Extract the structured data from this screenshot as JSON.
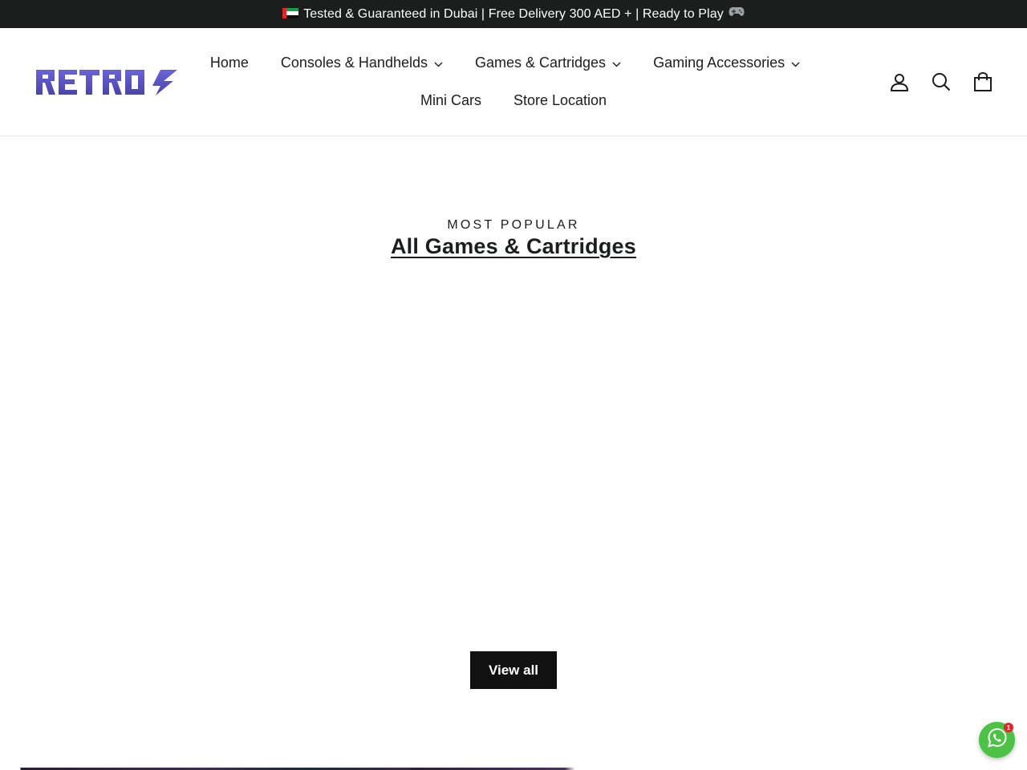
{
  "announcement": {
    "text": "Tested & Guaranteed in Dubai | Free Delivery 300 AED + | Ready to Play",
    "flag_icon": "uae-flag-icon",
    "trailing_icon": "gamepad-icon"
  },
  "header": {
    "logo_text": "RETROS",
    "logo_color": "#5b55c4",
    "nav": [
      {
        "label": "Home",
        "has_dropdown": false
      },
      {
        "label": "Consoles & Handhelds",
        "has_dropdown": true
      },
      {
        "label": "Games & Cartridges",
        "has_dropdown": true
      },
      {
        "label": "Gaming Accessories",
        "has_dropdown": true
      },
      {
        "label": "Mini Cars",
        "has_dropdown": false
      },
      {
        "label": "Store Location",
        "has_dropdown": false
      }
    ],
    "icons": [
      "account-icon",
      "search-icon",
      "cart-icon"
    ]
  },
  "section": {
    "subheading": "MOST POPULAR",
    "title": "All Games & Cartridges",
    "view_all_label": "View all"
  },
  "whatsapp": {
    "badge_count": "1",
    "color": "#4dc247"
  }
}
